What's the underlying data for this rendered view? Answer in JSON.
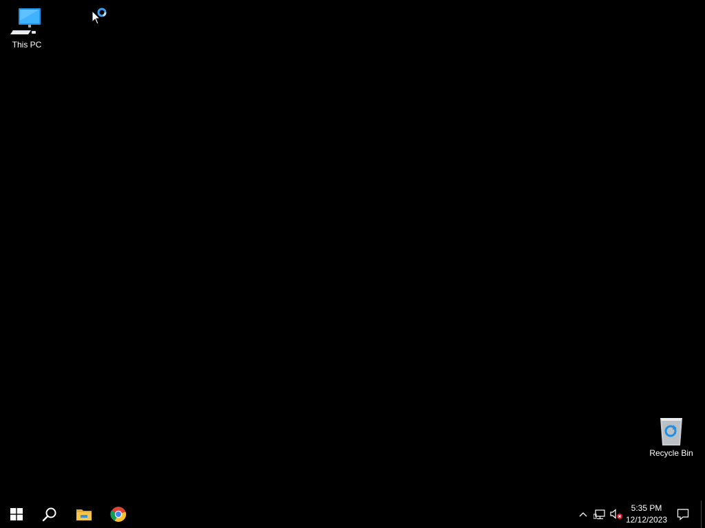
{
  "desktop": {
    "background_color": "#000000",
    "icons": [
      {
        "label": "This PC",
        "icon": "this-pc-icon"
      },
      {
        "label": "Recycle Bin",
        "icon": "recycle-bin-icon"
      }
    ]
  },
  "taskbar": {
    "background_color": "#000000",
    "pinned": [
      {
        "name": "Start",
        "icon": "windows-logo-icon"
      },
      {
        "name": "Search",
        "icon": "search-icon"
      },
      {
        "name": "File Explorer",
        "icon": "folder-icon"
      },
      {
        "name": "Google Chrome",
        "icon": "chrome-icon"
      }
    ],
    "tray": {
      "icons": [
        "chevron-up-icon",
        "network-icon",
        "volume-muted-icon",
        "notification-icon"
      ],
      "time": "5:35 PM",
      "date": "12/12/2023"
    }
  },
  "accent_color": "#0078d7"
}
